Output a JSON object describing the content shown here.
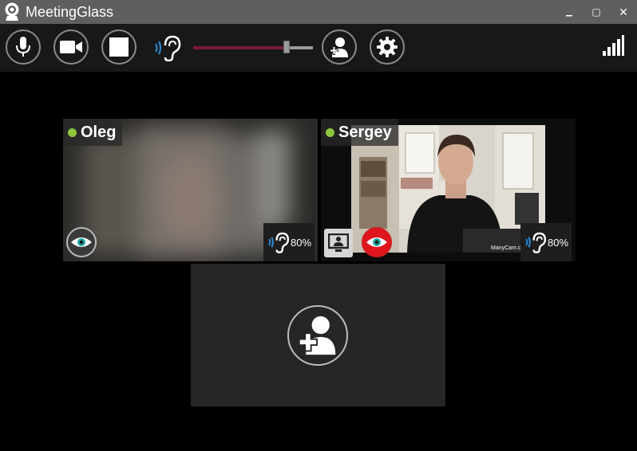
{
  "window": {
    "title": "MeetingGlass",
    "controls": {
      "minimize": "▁",
      "maximize": "▢",
      "close": "✕"
    }
  },
  "toolbar": {
    "volume_level": 0.78,
    "icons": [
      "microphone-icon",
      "video-camera-icon",
      "stop-icon",
      "ear-icon",
      "add-user-icon",
      "gear-icon",
      "signal-strength-icon"
    ]
  },
  "participants": [
    {
      "name": "Oleg",
      "status_color": "#8ec63f",
      "volume": "80%",
      "watching": true
    },
    {
      "name": "Sergey",
      "status_color": "#8ec63f",
      "volume": "80%",
      "watching": false,
      "sharing_screen": true,
      "watermark": "ManyCam.com"
    }
  ],
  "colors": {
    "titlebar": "#5f5f5f",
    "toolbar": "#181818",
    "accent_blue": "#2a8dd8",
    "eye_teal": "#1ba7a0",
    "record_red": "#e0161e",
    "volume_fill": "#7a1a33"
  }
}
